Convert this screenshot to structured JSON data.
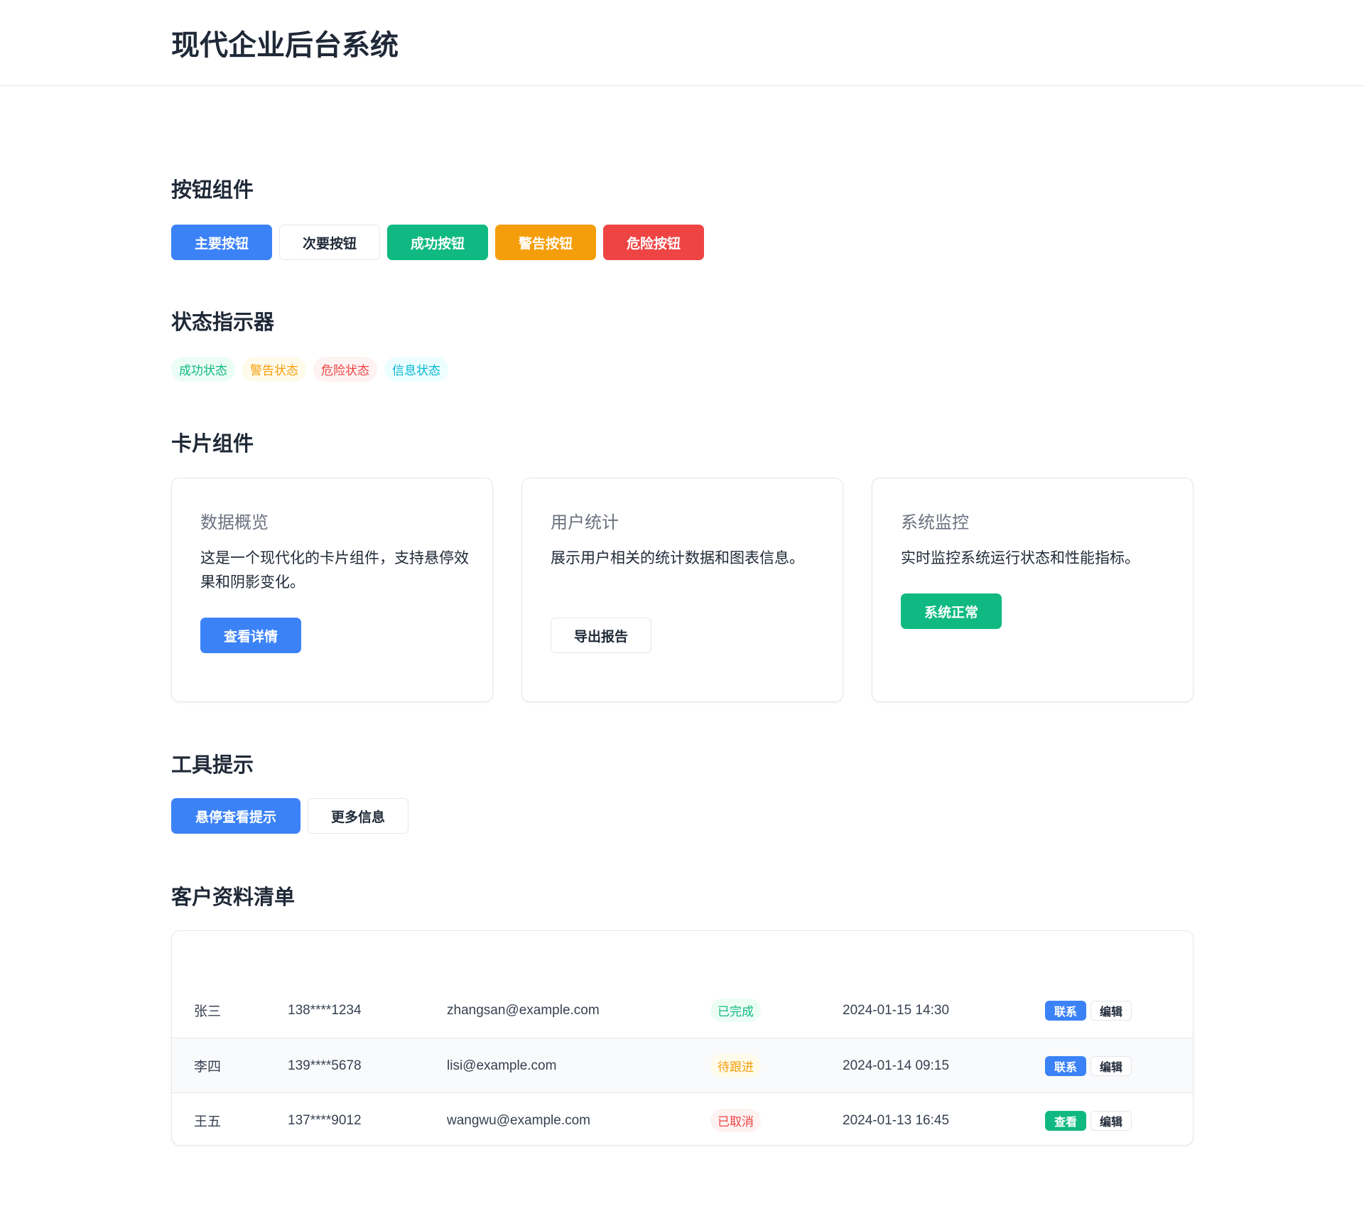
{
  "header": {
    "title": "现代企业后台系统"
  },
  "sections": {
    "buttons": "按钮组件",
    "status": "状态指示器",
    "cards": "卡片组件",
    "tooltip": "工具提示",
    "customers": "客户资料清单"
  },
  "buttons": {
    "primary": "主要按钮",
    "secondary": "次要按钮",
    "success": "成功按钮",
    "warning": "警告按钮",
    "danger": "危险按钮"
  },
  "badges": {
    "success": "成功状态",
    "warning": "警告状态",
    "danger": "危险状态",
    "info": "信息状态"
  },
  "cards": [
    {
      "title": "数据概览",
      "text": "这是一个现代化的卡片组件，支持悬停效果和阴影变化。",
      "button": "查看详情"
    },
    {
      "title": "用户统计",
      "text": "展示用户相关的统计数据和图表信息。",
      "button": "导出报告"
    },
    {
      "title": "系统监控",
      "text": "实时监控系统运行状态和性能指标。",
      "button": "系统正常"
    }
  ],
  "tooltip_buttons": {
    "hover": "悬停查看提示",
    "more": "更多信息"
  },
  "customers": [
    {
      "name": "张三",
      "phone": "138****1234",
      "email": "zhangsan@example.com",
      "status": "已完成",
      "time": "2024-01-15 14:30",
      "action1": "联系",
      "action2": "编辑"
    },
    {
      "name": "李四",
      "phone": "139****5678",
      "email": "lisi@example.com",
      "status": "待跟进",
      "time": "2024-01-14 09:15",
      "action1": "联系",
      "action2": "编辑"
    },
    {
      "name": "王五",
      "phone": "137****9012",
      "email": "wangwu@example.com",
      "status": "已取消",
      "time": "2024-01-13 16:45",
      "action1": "查看",
      "action2": "编辑"
    }
  ],
  "colors": {
    "primary": "#3b82f6",
    "success": "#10b981",
    "warning": "#f59e0b",
    "danger": "#ef4444",
    "info": "#06b6d4"
  }
}
